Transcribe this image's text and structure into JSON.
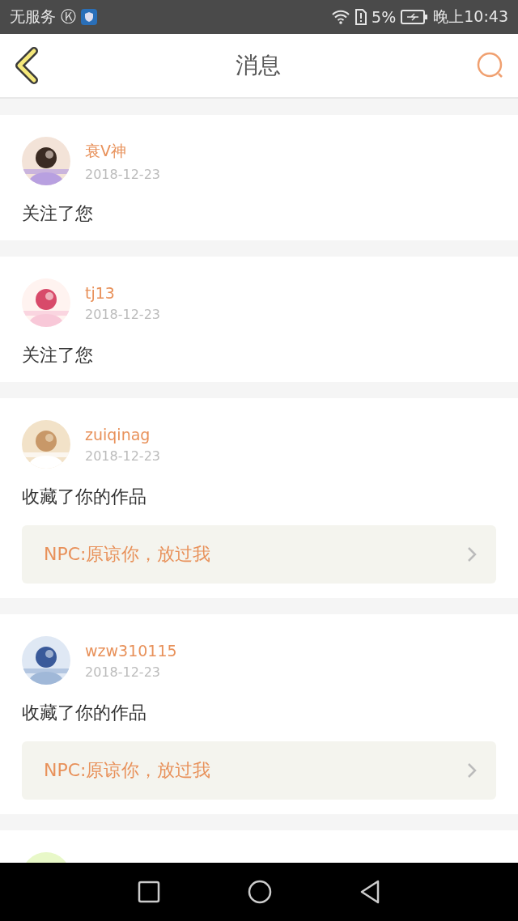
{
  "status_bar": {
    "carrier": "无服务",
    "carrier_badge": "Ⓚ",
    "battery": "5%",
    "time": "晚上10:43"
  },
  "header": {
    "title": "消息"
  },
  "messages": [
    {
      "user": "衰V神",
      "date": "2018-12-23",
      "action": "关注了您",
      "avatar": {
        "kind": "picture"
      }
    },
    {
      "user": "tj13",
      "date": "2018-12-23",
      "action": "关注了您",
      "avatar": {
        "kind": "picture"
      }
    },
    {
      "user": "zuiqinag",
      "date": "2018-12-23",
      "action": "收藏了你的作品",
      "work": "NPC:原谅你，放过我",
      "avatar": {
        "kind": "picture"
      }
    },
    {
      "user": "wzw310115",
      "date": "2018-12-23",
      "action": "收藏了你的作品",
      "work": "NPC:原谅你，放过我",
      "avatar": {
        "kind": "picture"
      }
    },
    {
      "avatar": {
        "kind": "picture"
      }
    }
  ]
}
